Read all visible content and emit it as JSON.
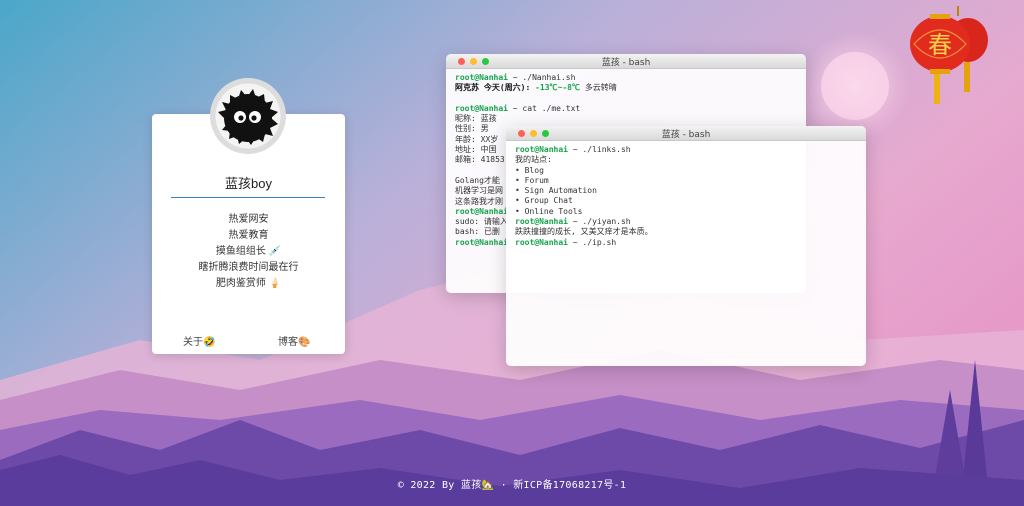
{
  "profile": {
    "name": "蓝孩boy",
    "bio": [
      "热爱网安",
      "热爱教育",
      "摸鱼组组长 💉",
      "瞎折腾浪费时间最在行",
      "肥肉鉴赏师 🍦"
    ],
    "links": {
      "about": "关于🤣",
      "blog": "博客🎨"
    }
  },
  "terminal_back": {
    "title": "蓝孩 - bash",
    "prompt": "root@Nanhai",
    "lines": [
      {
        "type": "cmd",
        "cmd": "~ ./Nanhai.sh"
      },
      {
        "type": "weather",
        "label": "阿克苏 今天(周六):",
        "temp": "-13℃~-8℃",
        "desc": "多云转晴"
      },
      {
        "type": "blank"
      },
      {
        "type": "cmd",
        "cmd": "~ cat ./me.txt"
      },
      {
        "type": "out",
        "text": "昵称: 蓝孩"
      },
      {
        "type": "out",
        "text": "性别: 男"
      },
      {
        "type": "out",
        "text": "年龄: XX岁"
      },
      {
        "type": "out",
        "text": "地址: 中国"
      },
      {
        "type": "out",
        "text": "邮箱: 41853"
      },
      {
        "type": "blank"
      },
      {
        "type": "out",
        "text": "Golang才能"
      },
      {
        "type": "out",
        "text": "机器学习是网"
      },
      {
        "type": "out",
        "text": "这条路我才刚"
      },
      {
        "type": "cmd",
        "cmd": ""
      },
      {
        "type": "out",
        "text": "sudo: 请输入"
      },
      {
        "type": "out",
        "text": "bash: 已删"
      },
      {
        "type": "cmd",
        "cmd": ""
      }
    ]
  },
  "terminal_front": {
    "title": "蓝孩 - bash",
    "prompt": "root@Nanhai",
    "lines": [
      {
        "type": "cmd",
        "cmd": "~ ./links.sh"
      },
      {
        "type": "out",
        "text": "我的站点:"
      },
      {
        "type": "out",
        "text": "• Blog"
      },
      {
        "type": "out",
        "text": "• Forum"
      },
      {
        "type": "out",
        "text": "• Sign Automation"
      },
      {
        "type": "out",
        "text": "• Group Chat"
      },
      {
        "type": "out",
        "text": "• Online Tools"
      },
      {
        "type": "cmd",
        "cmd": "~ ./yiyan.sh"
      },
      {
        "type": "out",
        "text": "跌跌撞撞的成长, 又美又痒才是本质。"
      },
      {
        "type": "cmd",
        "cmd": "~ ./ip.sh"
      }
    ]
  },
  "lantern": {
    "char": "春"
  },
  "footer": {
    "text": "© 2022 By 蓝孩🏡 · 新ICP备17068217号-1"
  },
  "colors": {
    "prompt": "#16a34a",
    "weather_temp": "#16a34a",
    "accent_line": "#3b82c4"
  }
}
